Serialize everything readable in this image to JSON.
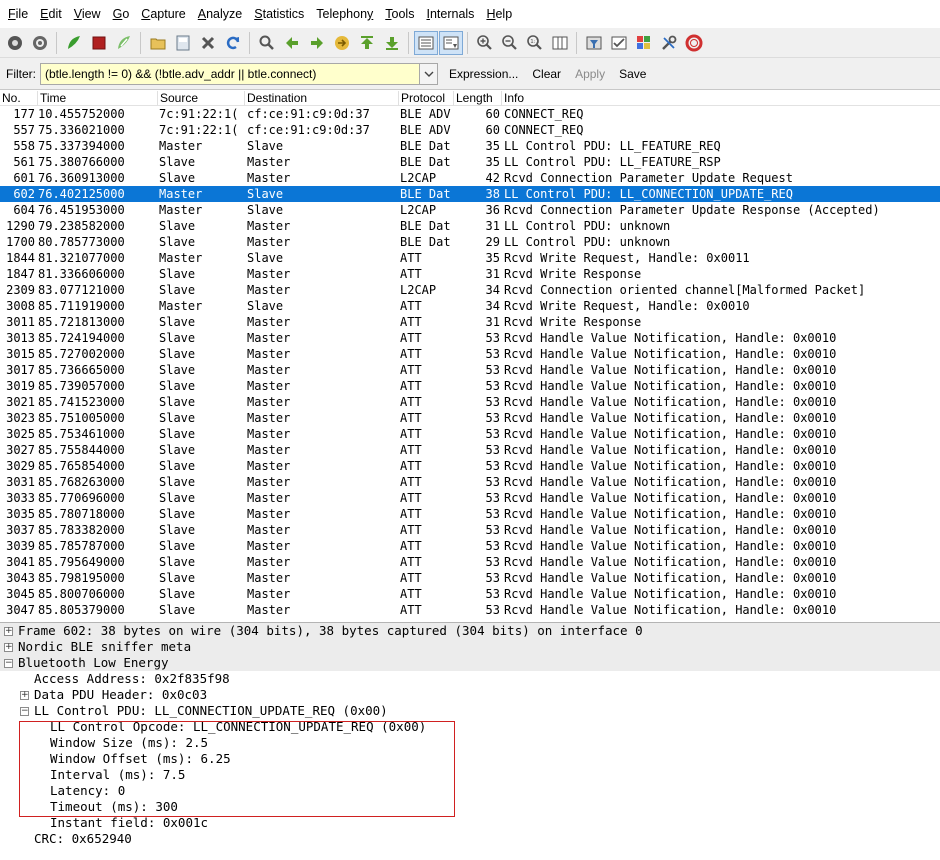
{
  "menu": [
    "File",
    "Edit",
    "View",
    "Go",
    "Capture",
    "Analyze",
    "Statistics",
    "Telephony",
    "Tools",
    "Internals",
    "Help"
  ],
  "menu_underline": [
    "F",
    "E",
    "V",
    "G",
    "C",
    "A",
    "S",
    "y",
    "T",
    "I",
    "H"
  ],
  "toolbar_icons": [
    "interface-list-icon",
    "capture-options-icon",
    "start-capture-icon",
    "stop-capture-icon",
    "restart-capture-icon",
    "open-file-icon",
    "save-file-icon",
    "close-file-icon",
    "reload-icon",
    "find-packet-icon",
    "go-back-icon",
    "go-forward-icon",
    "go-to-packet-icon",
    "go-first-icon",
    "go-last-icon",
    "colorize-icon",
    "auto-scroll-icon",
    "zoom-in-icon",
    "zoom-out-icon",
    "normal-size-icon",
    "resize-columns-icon",
    "capture-filters-icon",
    "display-filters-icon",
    "coloring-rules-icon",
    "preferences-icon",
    "help-icon"
  ],
  "filter": {
    "label": "Filter:",
    "value": "(btle.length != 0) && (!btle.adv_addr || btle.connect)",
    "expression": "Expression...",
    "clear": "Clear",
    "apply": "Apply",
    "save": "Save"
  },
  "columns": [
    "No.",
    "Time",
    "Source",
    "Destination",
    "Protocol",
    "Length",
    "Info"
  ],
  "packets": [
    {
      "no": "177",
      "time": "10.455752000",
      "src": "7c:91:22:1(",
      "dst": "cf:ce:91:c9:0d:37",
      "proto": "BLE ADV",
      "len": "60",
      "info": "CONNECT_REQ"
    },
    {
      "no": "557",
      "time": "75.336021000",
      "src": "7c:91:22:1(",
      "dst": "cf:ce:91:c9:0d:37",
      "proto": "BLE ADV",
      "len": "60",
      "info": "CONNECT_REQ"
    },
    {
      "no": "558",
      "time": "75.337394000",
      "src": "Master",
      "dst": "Slave",
      "proto": "BLE Dat",
      "len": "35",
      "info": "LL Control PDU: LL_FEATURE_REQ"
    },
    {
      "no": "561",
      "time": "75.380766000",
      "src": "Slave",
      "dst": "Master",
      "proto": "BLE Dat",
      "len": "35",
      "info": "LL Control PDU: LL_FEATURE_RSP"
    },
    {
      "no": "601",
      "time": "76.360913000",
      "src": "Slave",
      "dst": "Master",
      "proto": "L2CAP",
      "len": "42",
      "info": "Rcvd Connection Parameter Update Request"
    },
    {
      "no": "602",
      "time": "76.402125000",
      "src": "Master",
      "dst": "Slave",
      "proto": "BLE Dat",
      "len": "38",
      "info": "LL Control PDU: LL_CONNECTION_UPDATE_REQ",
      "selected": true
    },
    {
      "no": "604",
      "time": "76.451953000",
      "src": "Master",
      "dst": "Slave",
      "proto": "L2CAP",
      "len": "36",
      "info": "Rcvd Connection Parameter Update Response (Accepted)"
    },
    {
      "no": "1290",
      "time": "79.238582000",
      "src": "Slave",
      "dst": "Master",
      "proto": "BLE Dat",
      "len": "31",
      "info": "LL Control PDU: unknown"
    },
    {
      "no": "1700",
      "time": "80.785773000",
      "src": "Slave",
      "dst": "Master",
      "proto": "BLE Dat",
      "len": "29",
      "info": "LL Control PDU: unknown"
    },
    {
      "no": "1844",
      "time": "81.321077000",
      "src": "Master",
      "dst": "Slave",
      "proto": "ATT",
      "len": "35",
      "info": "Rcvd Write Request, Handle: 0x0011"
    },
    {
      "no": "1847",
      "time": "81.336606000",
      "src": "Slave",
      "dst": "Master",
      "proto": "ATT",
      "len": "31",
      "info": "Rcvd Write Response"
    },
    {
      "no": "2309",
      "time": "83.077121000",
      "src": "Slave",
      "dst": "Master",
      "proto": "L2CAP",
      "len": "34",
      "info": "Rcvd Connection oriented channel[Malformed Packet]"
    },
    {
      "no": "3008",
      "time": "85.711919000",
      "src": "Master",
      "dst": "Slave",
      "proto": "ATT",
      "len": "34",
      "info": "Rcvd Write Request, Handle: 0x0010"
    },
    {
      "no": "3011",
      "time": "85.721813000",
      "src": "Slave",
      "dst": "Master",
      "proto": "ATT",
      "len": "31",
      "info": "Rcvd Write Response"
    },
    {
      "no": "3013",
      "time": "85.724194000",
      "src": "Slave",
      "dst": "Master",
      "proto": "ATT",
      "len": "53",
      "info": "Rcvd Handle Value Notification, Handle: 0x0010"
    },
    {
      "no": "3015",
      "time": "85.727002000",
      "src": "Slave",
      "dst": "Master",
      "proto": "ATT",
      "len": "53",
      "info": "Rcvd Handle Value Notification, Handle: 0x0010"
    },
    {
      "no": "3017",
      "time": "85.736665000",
      "src": "Slave",
      "dst": "Master",
      "proto": "ATT",
      "len": "53",
      "info": "Rcvd Handle Value Notification, Handle: 0x0010"
    },
    {
      "no": "3019",
      "time": "85.739057000",
      "src": "Slave",
      "dst": "Master",
      "proto": "ATT",
      "len": "53",
      "info": "Rcvd Handle Value Notification, Handle: 0x0010"
    },
    {
      "no": "3021",
      "time": "85.741523000",
      "src": "Slave",
      "dst": "Master",
      "proto": "ATT",
      "len": "53",
      "info": "Rcvd Handle Value Notification, Handle: 0x0010"
    },
    {
      "no": "3023",
      "time": "85.751005000",
      "src": "Slave",
      "dst": "Master",
      "proto": "ATT",
      "len": "53",
      "info": "Rcvd Handle Value Notification, Handle: 0x0010"
    },
    {
      "no": "3025",
      "time": "85.753461000",
      "src": "Slave",
      "dst": "Master",
      "proto": "ATT",
      "len": "53",
      "info": "Rcvd Handle Value Notification, Handle: 0x0010"
    },
    {
      "no": "3027",
      "time": "85.755844000",
      "src": "Slave",
      "dst": "Master",
      "proto": "ATT",
      "len": "53",
      "info": "Rcvd Handle Value Notification, Handle: 0x0010"
    },
    {
      "no": "3029",
      "time": "85.765854000",
      "src": "Slave",
      "dst": "Master",
      "proto": "ATT",
      "len": "53",
      "info": "Rcvd Handle Value Notification, Handle: 0x0010"
    },
    {
      "no": "3031",
      "time": "85.768263000",
      "src": "Slave",
      "dst": "Master",
      "proto": "ATT",
      "len": "53",
      "info": "Rcvd Handle Value Notification, Handle: 0x0010"
    },
    {
      "no": "3033",
      "time": "85.770696000",
      "src": "Slave",
      "dst": "Master",
      "proto": "ATT",
      "len": "53",
      "info": "Rcvd Handle Value Notification, Handle: 0x0010"
    },
    {
      "no": "3035",
      "time": "85.780718000",
      "src": "Slave",
      "dst": "Master",
      "proto": "ATT",
      "len": "53",
      "info": "Rcvd Handle Value Notification, Handle: 0x0010"
    },
    {
      "no": "3037",
      "time": "85.783382000",
      "src": "Slave",
      "dst": "Master",
      "proto": "ATT",
      "len": "53",
      "info": "Rcvd Handle Value Notification, Handle: 0x0010"
    },
    {
      "no": "3039",
      "time": "85.785787000",
      "src": "Slave",
      "dst": "Master",
      "proto": "ATT",
      "len": "53",
      "info": "Rcvd Handle Value Notification, Handle: 0x0010"
    },
    {
      "no": "3041",
      "time": "85.795649000",
      "src": "Slave",
      "dst": "Master",
      "proto": "ATT",
      "len": "53",
      "info": "Rcvd Handle Value Notification, Handle: 0x0010"
    },
    {
      "no": "3043",
      "time": "85.798195000",
      "src": "Slave",
      "dst": "Master",
      "proto": "ATT",
      "len": "53",
      "info": "Rcvd Handle Value Notification, Handle: 0x0010"
    },
    {
      "no": "3045",
      "time": "85.800706000",
      "src": "Slave",
      "dst": "Master",
      "proto": "ATT",
      "len": "53",
      "info": "Rcvd Handle Value Notification, Handle: 0x0010"
    },
    {
      "no": "3047",
      "time": "85.805379000",
      "src": "Slave",
      "dst": "Master",
      "proto": "ATT",
      "len": "53",
      "info": "Rcvd Handle Value Notification, Handle: 0x0010"
    }
  ],
  "details": [
    {
      "text": "Frame 602: 38 bytes on wire (304 bits), 38 bytes captured (304 bits) on interface 0",
      "indent": 0,
      "expander": "+",
      "band": true
    },
    {
      "text": "Nordic BLE sniffer meta",
      "indent": 0,
      "expander": "+",
      "band": true
    },
    {
      "text": "Bluetooth Low Energy",
      "indent": 0,
      "expander": "-",
      "band": true
    },
    {
      "text": "Access Address: 0x2f835f98",
      "indent": 2,
      "expander": "",
      "band": false
    },
    {
      "text": "Data PDU Header: 0x0c03",
      "indent": 1,
      "expander": "+",
      "band": false
    },
    {
      "text": "LL Control PDU: LL_CONNECTION_UPDATE_REQ (0x00)",
      "indent": 1,
      "expander": "-",
      "band": false
    },
    {
      "text": "LL Control Opcode: LL_CONNECTION_UPDATE_REQ (0x00)",
      "indent": 3,
      "expander": "",
      "band": false
    },
    {
      "text": "Window Size (ms): 2.5",
      "indent": 3,
      "expander": "",
      "band": false
    },
    {
      "text": "Window Offset (ms): 6.25",
      "indent": 3,
      "expander": "",
      "band": false
    },
    {
      "text": "Interval (ms): 7.5",
      "indent": 3,
      "expander": "",
      "band": false
    },
    {
      "text": "Latency: 0",
      "indent": 3,
      "expander": "",
      "band": false
    },
    {
      "text": "Timeout (ms): 300",
      "indent": 3,
      "expander": "",
      "band": false
    },
    {
      "text": "Instant field: 0x001c",
      "indent": 3,
      "expander": "",
      "band": false
    },
    {
      "text": "CRC: 0x652940",
      "indent": 2,
      "expander": "",
      "band": false
    }
  ],
  "colors": {
    "selected_row": "#0b76d6",
    "filter_bg": "#ffffcc",
    "highlight_box": "#d02020"
  }
}
